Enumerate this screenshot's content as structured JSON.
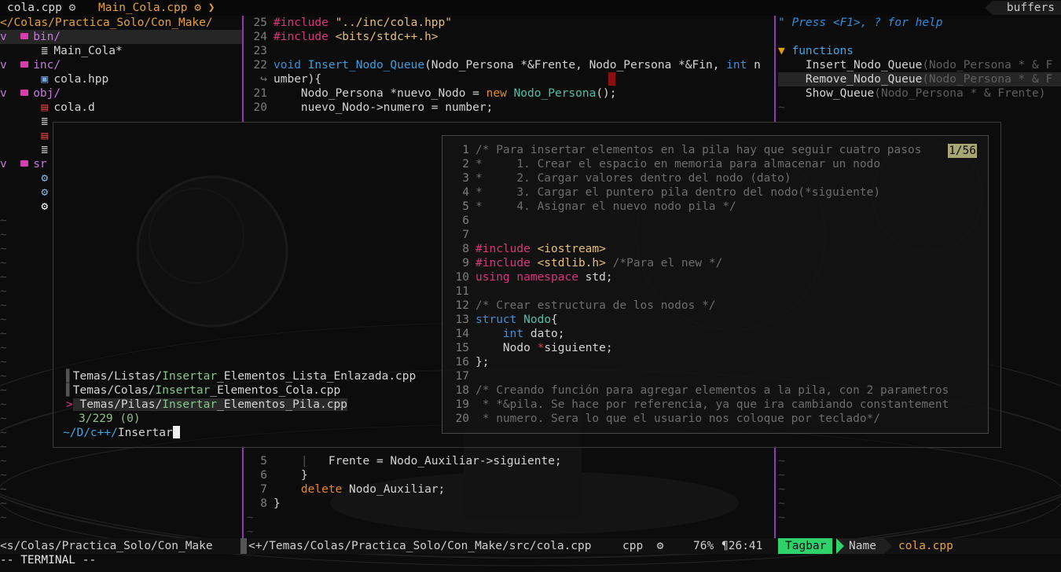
{
  "tabline": {
    "active_tab": "cola.cpp",
    "other_tab": "Main_Cola.cpp",
    "buffers_label": "buffers"
  },
  "nerdtree": {
    "root": "</Colas/Practica_Solo/Con_Make/",
    "dir_bin": "bin/",
    "file_main_cola": "Main_Cola*",
    "dir_inc": "inc/",
    "file_cola_hpp": "cola.hpp",
    "dir_obj": "obj/",
    "file_cola_d": "cola.d",
    "dir_src_partial": "sr"
  },
  "editor_top": {
    "lines": [
      {
        "n": "25",
        "text": "#include \"../inc/cola.hpp\""
      },
      {
        "n": "24",
        "text": "#include <bits/stdc++.h>"
      },
      {
        "n": "23",
        "text": ""
      },
      {
        "n": "22",
        "text": "void Insert_Nodo_Queue(Nodo_Persona *&Frente, Nodo_Persona *&Fin, int n"
      },
      {
        "n": "",
        "text": "umber){"
      },
      {
        "n": "21",
        "text": "Nodo_Persona *nuevo_Nodo = new Nodo_Persona();"
      },
      {
        "n": "20",
        "text": "nuevo_Nodo->numero = number;"
      }
    ]
  },
  "editor_bottom": {
    "lines": [
      {
        "n": "5",
        "text": "|   Frente = Nodo_Auxiliar->siguiente;"
      },
      {
        "n": "6",
        "text": "}"
      },
      {
        "n": "7",
        "text": "delete Nodo_Auxiliar;"
      },
      {
        "n": "8",
        "text": "}"
      }
    ]
  },
  "tagbar": {
    "help": "\" Press <F1>, ? for help",
    "section": "functions",
    "items": [
      {
        "name": "Insert_Nodo_Queue",
        "args": "(Nodo_Persona * & F"
      },
      {
        "name": "Remove_Nodo_Queue",
        "args": "(Nodo_Persona * & F"
      },
      {
        "name": "Show_Queue",
        "args": "(Nodo_Persona * & Frente)"
      }
    ]
  },
  "fzf": {
    "results": [
      {
        "prefix": "Temas/Listas/",
        "match": "Insertar",
        "rest": "_Elementos_Lista_Enlazada.cpp"
      },
      {
        "prefix": "Temas/Colas/",
        "match": "Insertar",
        "rest": "_Elementos_Cola.cpp"
      },
      {
        "prefix": "Temas/Pilas/",
        "match": "Insertar",
        "rest": "_Elementos_Pila.cpp"
      }
    ],
    "pointer": ">",
    "count": "3/229 (0)",
    "prompt": "~/D/c++/",
    "query": "Insertar"
  },
  "preview": {
    "counter": "1/56",
    "lines": [
      {
        "n": "1",
        "text": "/* Para insertar elementos en la pila hay que seguir cuatro pasos"
      },
      {
        "n": "2",
        "text": "*     1. Crear el espacio en memoria para almacenar un nodo"
      },
      {
        "n": "3",
        "text": "*     2. Cargar valores dentro del nodo (dato)"
      },
      {
        "n": "4",
        "text": "*     3. Cargar el puntero pila dentro del nodo(*siguiente)"
      },
      {
        "n": "5",
        "text": "*     4. Asignar el nuevo nodo pila */"
      },
      {
        "n": "6",
        "text": ""
      },
      {
        "n": "7",
        "text": ""
      },
      {
        "n": "8",
        "text": "#include <iostream>"
      },
      {
        "n": "9",
        "text": "#include <stdlib.h> /*Para el new */"
      },
      {
        "n": "10",
        "text": "using namespace std;"
      },
      {
        "n": "11",
        "text": ""
      },
      {
        "n": "12",
        "text": "/* Crear estructura de los nodos */"
      },
      {
        "n": "13",
        "text": "struct Nodo{"
      },
      {
        "n": "14",
        "text": "    int dato;"
      },
      {
        "n": "15",
        "text": "    Nodo *siguiente;"
      },
      {
        "n": "16",
        "text": "};"
      },
      {
        "n": "17",
        "text": ""
      },
      {
        "n": "18",
        "text": "/* Creando función para agregar elementos a la pila, con 2 parametros"
      },
      {
        "n": "19",
        "text": " * *&pila. Se hace por referencia, ya que ira cambiando constantement"
      },
      {
        "n": "20",
        "text": " * numero. Sera lo que el usuario nos coloque por teclado*/"
      }
    ]
  },
  "statusline": {
    "left_path": "<s/Colas/Practica_Solo/Con_Make",
    "file_path": "<+/Temas/Colas/Practica_Solo/Con_Make/src/cola.cpp",
    "filetype": "cpp",
    "percent": "76%",
    "position": "¶26:41",
    "tagbar_mode": "Tagbar",
    "tagbar_name": "Name",
    "tagbar_file": "cola.cpp"
  },
  "cmdline": "-- TERMINAL --",
  "colors": {
    "directory": "#c678dd",
    "fzf_match": "#83c98b",
    "tagbar_green": "#2fd26a",
    "tab_orange": "#e5a13a"
  }
}
